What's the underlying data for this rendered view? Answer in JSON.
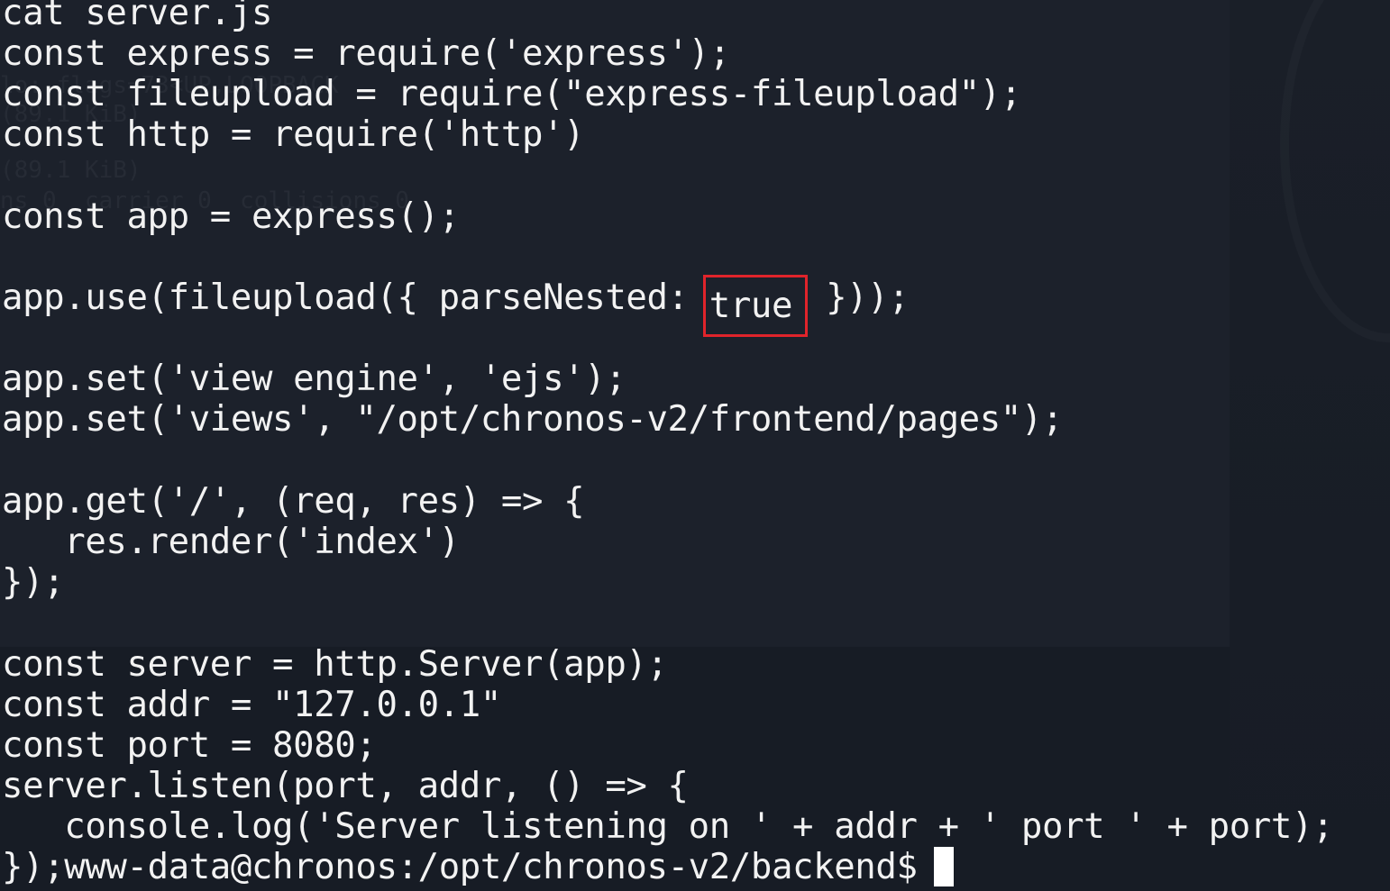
{
  "terminal": {
    "ghost_lines": [
      "lo: flags=73<UP,LOOPBACK",
      "(89.1 KiB)",
      "(89.1 KiB)",
      "ns 0  carrier 0  collisions 0"
    ],
    "lines": {
      "l1": "cat server.js",
      "l2": "const express = require('express');",
      "l3": "const fileupload = require(\"express-fileupload\");",
      "l4": "const http = require('http')",
      "l6": "const app = express();",
      "l8_pre": "app.use(fileupload({ parseNested: ",
      "l8_hl": "true",
      "l8_post": " }));",
      "l10": "app.set('view engine', 'ejs');",
      "l11": "app.set('views', \"/opt/chronos-v2/frontend/pages\");",
      "l13": "app.get('/', (req, res) => {",
      "l14": "   res.render('index')",
      "l15": "});",
      "l17": "const server = http.Server(app);",
      "l18": "const addr = \"127.0.0.1\"",
      "l19": "const port = 8080;",
      "l20": "server.listen(port, addr, () => {",
      "l21": "   console.log('Server listening on ' + addr + ' port ' + port);",
      "l22_out": "});",
      "l22_prompt": "www-data@chronos:/opt/chronos-v2/backend$"
    },
    "colors": {
      "background": "#171c25",
      "text": "#f2f2f2",
      "highlight_box": "#e0242b",
      "cursor": "#ffffff"
    }
  }
}
